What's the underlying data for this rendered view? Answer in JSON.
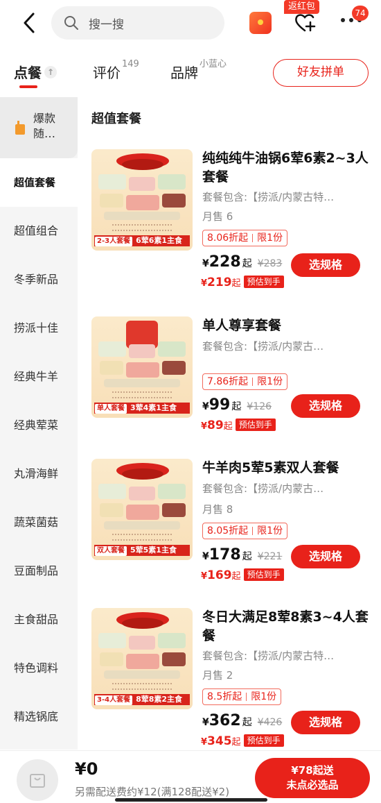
{
  "topbar": {
    "search_placeholder": "搜一搜",
    "red_envelope_badge": "返红包",
    "message_count": "74"
  },
  "tabs": {
    "order": "点餐",
    "review": "评价",
    "review_count": "149",
    "brand": "品牌",
    "brand_sub": "小蓝心",
    "friend_button": "好友拼单"
  },
  "sidebar": {
    "items": [
      "爆款随…",
      "超值套餐",
      "超值组合",
      "冬季新品",
      "捞派十佳",
      "经典牛羊",
      "经典荤菜",
      "丸滑海鲜",
      "蔬菜菌菇",
      "豆面制品",
      "主食甜品",
      "特色调料",
      "精选锅底"
    ],
    "active_index": 1
  },
  "section_title": "超值套餐",
  "products": [
    {
      "name": "纯纯纯牛油锅6荤6素2~3人套餐",
      "desc": "套餐包含:【捞派/内蒙古特…",
      "sold": "月售 6",
      "discount": "8.06折起",
      "limit": "限1份",
      "price": "228",
      "unit": "起",
      "orig_price": "¥283",
      "est_price": "219",
      "est_tag": "预估到手",
      "button": "选规格",
      "thumb_left": "2-3人套餐",
      "thumb_right": "6荤6素1主食"
    },
    {
      "name": "单人尊享套餐",
      "desc": "套餐包含:【捞派/内蒙古…",
      "sold": "",
      "discount": "7.86折起",
      "limit": "限1份",
      "price": "99",
      "unit": "起",
      "orig_price": "¥126",
      "est_price": "89",
      "est_tag": "预估到手",
      "button": "选规格",
      "thumb_left": "单人套餐",
      "thumb_right": "3荤4素1主食"
    },
    {
      "name": "牛羊肉5荤5素双人套餐",
      "desc": "套餐包含:【捞派/内蒙古…",
      "sold": "月售 8",
      "discount": "8.05折起",
      "limit": "限1份",
      "price": "178",
      "unit": "起",
      "orig_price": "¥221",
      "est_price": "169",
      "est_tag": "预估到手",
      "button": "选规格",
      "thumb_left": "双人套餐",
      "thumb_right": "5荤5素1主食"
    },
    {
      "name": "冬日大满足8荤8素3~4人套餐",
      "desc": "套餐包含:【捞派/内蒙古特…",
      "sold": "月售 2",
      "discount": "8.5折起",
      "limit": "限1份",
      "price": "362",
      "unit": "起",
      "orig_price": "¥426",
      "est_price": "345",
      "est_tag": "预估到手",
      "button": "选规格",
      "thumb_left": "3-4人套餐",
      "thumb_right": "8荤8素2主食"
    }
  ],
  "currency": "¥",
  "bottom": {
    "total": "¥0",
    "delivery_note": "另需配送费约¥12(满128配送¥2)",
    "checkout_line1": "¥78起送",
    "checkout_line2": "未点必选品"
  },
  "colors": {
    "accent": "#e8221a",
    "sidebar_bg": "#f5f5f5"
  },
  "icons": [
    "back-arrow-icon",
    "search-icon",
    "red-envelope-icon",
    "favorite-heart-plus-icon",
    "more-dots-icon",
    "pin-top-icon",
    "drink-cup-icon",
    "shopping-bag-icon"
  ]
}
